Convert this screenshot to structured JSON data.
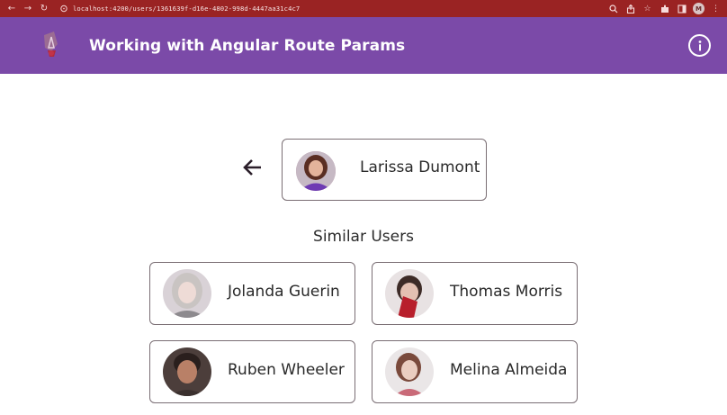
{
  "browser": {
    "url": "localhost:4200/users/1361639f-d16e-4802-998d-4447aa31c4c7",
    "profile_initial": "M",
    "icons": [
      "back-icon",
      "forward-icon",
      "reload-icon",
      "lock-icon",
      "zoom-icon",
      "share-icon",
      "star-icon",
      "extensions-icon",
      "sidebar-icon",
      "menu-icon"
    ]
  },
  "toolbar": {
    "title": "Working with Angular Route Params",
    "background": "#7b4aa8",
    "info_icon": "info-icon",
    "logo_icon": "angular-logo-icon"
  },
  "current_user": {
    "name": "Larissa Dumont"
  },
  "back_icon": "arrow-left-icon",
  "similar": {
    "title": "Similar Users",
    "users": [
      {
        "name": "Jolanda Guerin"
      },
      {
        "name": "Thomas Morris"
      },
      {
        "name": "Ruben Wheeler"
      },
      {
        "name": "Melina Almeida"
      }
    ]
  }
}
